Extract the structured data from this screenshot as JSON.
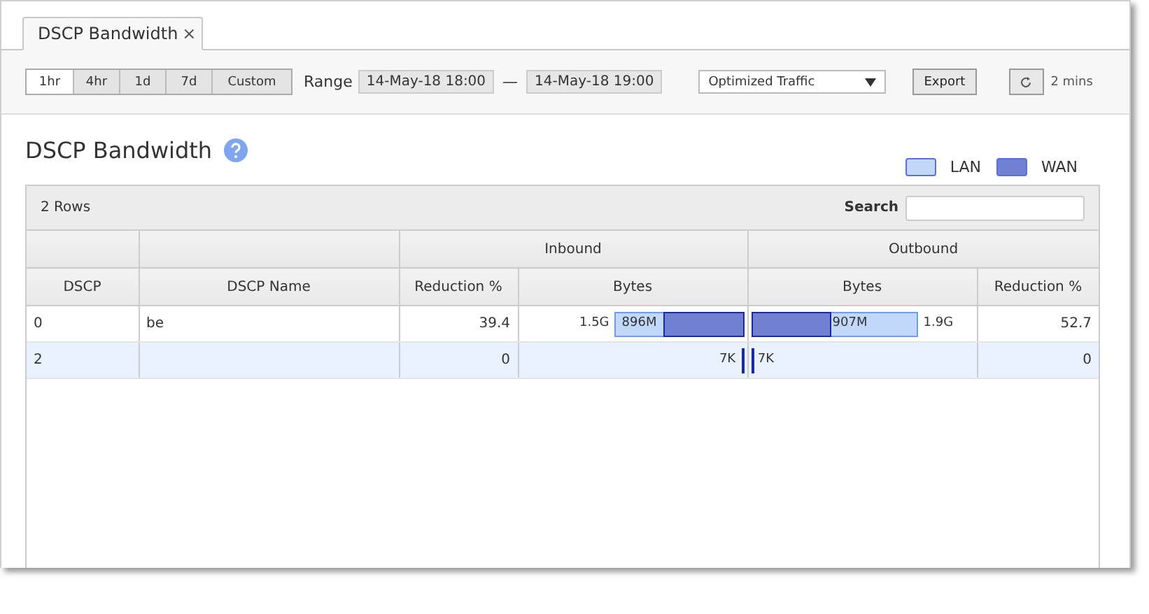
{
  "tab": {
    "label": "DSCP Bandwidth",
    "close": "×"
  },
  "toolbar": {
    "ranges": [
      {
        "label": "1hr",
        "selected": true
      },
      {
        "label": "4hr",
        "selected": false
      },
      {
        "label": "1d",
        "selected": false
      },
      {
        "label": "7d",
        "selected": false
      },
      {
        "label": "Custom",
        "selected": false
      }
    ],
    "range_label": "Range",
    "range_start": "14-May-18 18:00",
    "range_sep": "—",
    "range_end": "14-May-18 19:00",
    "traffic_select": "Optimized Traffic",
    "export": "Export",
    "refresh_interval": "2 mins"
  },
  "title": "DSCP Bandwidth",
  "legend": [
    {
      "label": "LAN",
      "color": "#c2d8fb"
    },
    {
      "label": "WAN",
      "color": "#7180d1"
    }
  ],
  "table": {
    "row_count": "2 Rows",
    "search_label": "Search",
    "groups": [
      "Inbound",
      "Outbound"
    ],
    "columns": [
      "DSCP",
      "DSCP Name",
      "Reduction %",
      "Bytes",
      "Bytes",
      "Reduction %"
    ],
    "rows": [
      {
        "dscp": "0",
        "name": "be",
        "in_reduction": "39.4",
        "in_total": "1.5G",
        "in_lan": {
          "level": 0.58
        },
        "in_wan_bar": {
          "level": 0.36
        },
        "in_wan": "896M",
        "out_wan": "907M",
        "out_lan": {
          "level": 0.75
        },
        "out_wan_bar": {
          "level": 0.36
        },
        "out_total": "1.9G",
        "out_reduction": "52.7",
        "selected": false
      },
      {
        "dscp": "2",
        "in_reduction": "0",
        "in_total": "7K",
        "in_lan": {
          "level": 0.012
        },
        "in_wan_bar": {
          "level": 0.012
        },
        "out_wan": "7K",
        "out_lan": {
          "level": 0.012
        },
        "out_wan_bar": {
          "level": 0.012
        },
        "out_reduction": "0",
        "selected": true
      }
    ]
  }
}
